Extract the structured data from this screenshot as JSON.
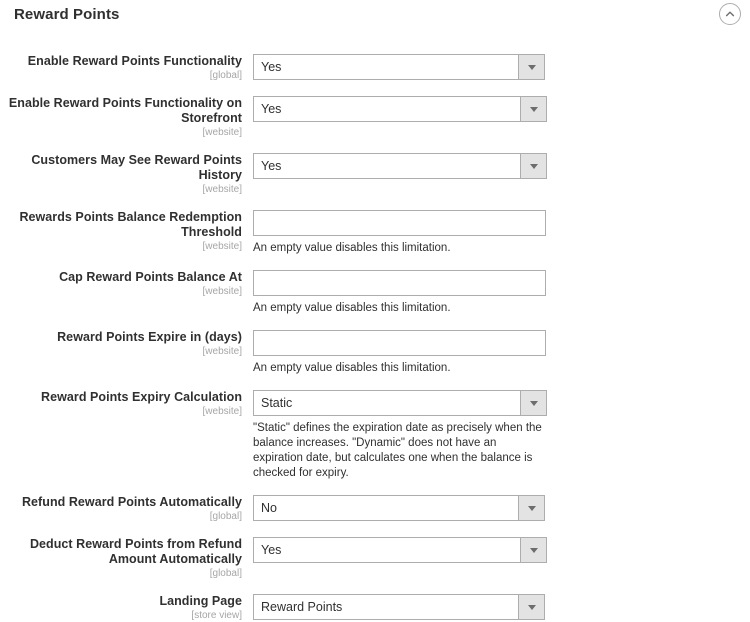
{
  "section": {
    "title": "Reward Points",
    "collapse_icon": "chevron-up-circle-icon"
  },
  "scopes": {
    "global": "[global]",
    "website": "[website]",
    "store_view": "[store view]"
  },
  "notes": {
    "empty_disables": "An empty value disables this limitation.",
    "expiry_calculation": "\"Static\" defines the expiration date as precisely when the balance increases. \"Dynamic\" does not have an expiration date, but calculates one when the balance is checked for expiry."
  },
  "fields": [
    {
      "id": "enable-reward-points-functionality",
      "label": "Enable Reward Points Functionality",
      "scope": "[global]",
      "type": "select",
      "value": "Yes",
      "width": "narrow",
      "note": ""
    },
    {
      "id": "enable-reward-points-functionality-on-storefront",
      "label": "Enable Reward Points Functionality on Storefront",
      "scope": "[website]",
      "type": "select",
      "value": "Yes",
      "width": "wide",
      "note": ""
    },
    {
      "id": "customers-may-see-reward-points-history",
      "label": "Customers May See Reward Points History",
      "scope": "[website]",
      "type": "select",
      "value": "Yes",
      "width": "wide",
      "note": ""
    },
    {
      "id": "rewards-points-balance-redemption-threshold",
      "label": "Rewards Points Balance Redemption Threshold",
      "scope": "[website]",
      "type": "text",
      "value": "",
      "note": "An empty value disables this limitation."
    },
    {
      "id": "cap-reward-points-balance-at",
      "label": "Cap Reward Points Balance At",
      "scope": "[website]",
      "type": "text",
      "value": "",
      "note": "An empty value disables this limitation."
    },
    {
      "id": "reward-points-expire-in-days",
      "label": "Reward Points Expire in (days)",
      "scope": "[website]",
      "type": "text",
      "value": "",
      "note": "An empty value disables this limitation."
    },
    {
      "id": "reward-points-expiry-calculation",
      "label": "Reward Points Expiry Calculation",
      "scope": "[website]",
      "type": "select",
      "value": "Static",
      "width": "wide",
      "note": "\"Static\" defines the expiration date as precisely when the balance increases. \"Dynamic\" does not have an expiration date, but calculates one when the balance is checked for expiry."
    },
    {
      "id": "refund-reward-points-automatically",
      "label": "Refund Reward Points Automatically",
      "scope": "[global]",
      "type": "select",
      "value": "No",
      "width": "narrow",
      "note": ""
    },
    {
      "id": "deduct-reward-points-from-refund-amount-automatically",
      "label": "Deduct Reward Points from Refund Amount Automatically",
      "scope": "[global]",
      "type": "select",
      "value": "Yes",
      "width": "wide",
      "note": ""
    },
    {
      "id": "landing-page",
      "label": "Landing Page",
      "scope": "[store view]",
      "type": "select",
      "value": "Reward Points",
      "width": "narrow",
      "note": ""
    }
  ]
}
